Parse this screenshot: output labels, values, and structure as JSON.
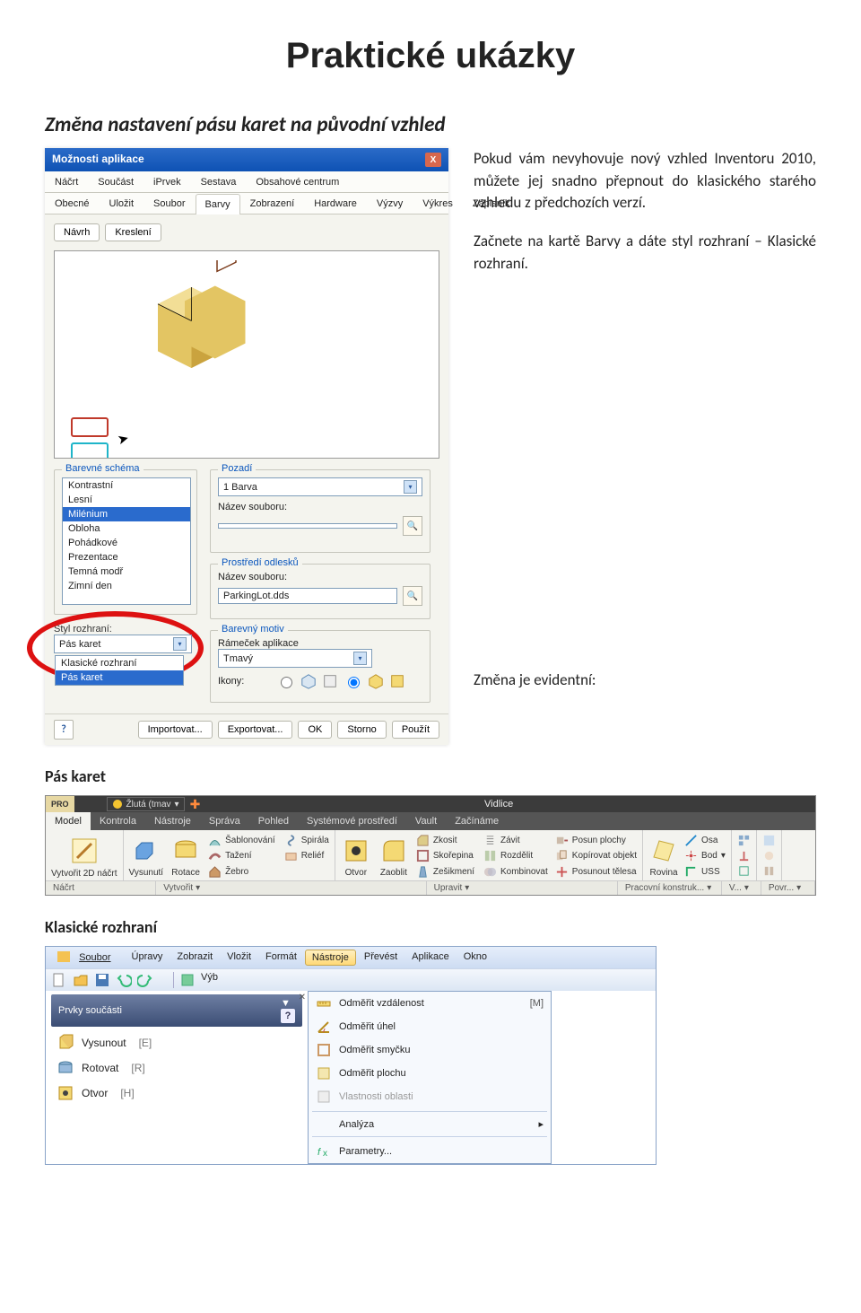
{
  "title": "Praktické ukázky",
  "section_title": "Změna nastavení pásu karet na původní vzhled",
  "p1": "Pokud vám nevyhovuje nový vzhled Inventoru 2010, můžete jej snadno přepnout do klasického starého vzhledu z předchozích verzí.",
  "p2": "Začnete na kartě Barvy a dáte styl rozhraní – Klasické rozhraní.",
  "change_label": "Změna je evidentní:",
  "ribbon_heading": "Pás karet",
  "classic_heading": "Klasické rozhraní",
  "dlg": {
    "title": "Možnosti aplikace",
    "close": "X",
    "tabs_top": [
      "Náčrt",
      "Součást",
      "iPrvek",
      "Sestava",
      "Obsahové centrum"
    ],
    "tabs_bottom": [
      "Obecné",
      "Uložit",
      "Soubor",
      "Barvy",
      "Zobrazení",
      "Hardware",
      "Výzvy",
      "Výkres",
      "Zápisník"
    ],
    "btn_navrh": "Návrh",
    "btn_kresleni": "Kreslení",
    "schema_label": "Barevné schéma",
    "schema_items": [
      "Kontrastní",
      "Lesní",
      "Milénium",
      "Obloha",
      "Pohádkové",
      "Prezentace",
      "Temná modř",
      "Zimní den"
    ],
    "schema_selected_index": 2,
    "pozadi_label": "Pozadí",
    "pozadi_value": "1 Barva",
    "nazev1_label": "Název souboru:",
    "odlesku_label": "Prostředí odlesků",
    "nm2_label": "Název souboru:",
    "nm2_value": "ParkingLot.dds",
    "motiv_label": "Barevný motiv",
    "ramecek_label": "Rámeček aplikace",
    "ramecek_value": "Tmavý",
    "ikony_label": "Ikony:",
    "styl_label": "Styl rozhraní:",
    "styl_value": "Pás karet",
    "styl_options": [
      "Klasické rozhraní",
      "Pás karet"
    ],
    "styl_sel_index": 1,
    "footer": [
      "Importovat...",
      "Exportovat...",
      "OK",
      "Storno",
      "Použít"
    ]
  },
  "ribbon": {
    "top_combo": "Žlutá (tmav",
    "title": "Vidlice",
    "tabs": [
      "Model",
      "Kontrola",
      "Nástroje",
      "Správa",
      "Pohled",
      "Systémové prostředí",
      "Vault",
      "Začínáme"
    ],
    "vytvorit": "Vytvořit 2D náčrt",
    "vysunuti": "Vysunutí",
    "rotace": "Rotace",
    "sab": "Šablonování",
    "spir": "Spirála",
    "taz": "Tažení",
    "rel": "Reliéf",
    "zebro": "Žebro",
    "otvor": "Otvor",
    "zaoblit": "Zaoblit",
    "zkosit": "Zkosit",
    "zavit": "Závit",
    "skor": "Skořepina",
    "rozd": "Rozdělit",
    "zesik": "Zešikmení",
    "komb": "Kombinovat",
    "posun": "Posun plochy",
    "kop": "Kopírovat objekt",
    "pos": "Posunout tělesa",
    "rovina": "Rovina",
    "osa": "Osa",
    "bod": "Bod",
    "uss": "USS",
    "f_nacrt": "Náčrt",
    "f_vytv": "Vytvořit",
    "f_uprav": "Upravit",
    "f_prac": "Pracovní konstruk...",
    "f_v": "V...",
    "f_povr": "Povr..."
  },
  "classic": {
    "menus": [
      "Soubor",
      "Úpravy",
      "Zobrazit",
      "Vložit",
      "Formát",
      "Nástroje",
      "Převést",
      "Aplikace",
      "Okno"
    ],
    "tb_vyb": "Výb",
    "panel_title": "Prvky součásti",
    "items": [
      {
        "t": "Vysunout",
        "k": "[E]",
        "icon": "extrude"
      },
      {
        "t": "Rotovat",
        "k": "[R]",
        "icon": "revolve"
      },
      {
        "t": "Otvor",
        "k": "[H]",
        "icon": "hole"
      }
    ],
    "drop": [
      {
        "t": "Odměřit vzdálenost",
        "k": "[M]",
        "icon": "dist"
      },
      {
        "t": "Odměřit úhel",
        "icon": "angle"
      },
      {
        "t": "Odměřit smyčku",
        "icon": "loop"
      },
      {
        "t": "Odměřit plochu",
        "icon": "area"
      },
      {
        "t": "Vlastnosti oblasti",
        "icon": "props",
        "disabled": true
      },
      {
        "t": "Analýza",
        "arrow": true
      },
      {
        "t": "Parametry...",
        "icon": "params"
      }
    ]
  }
}
